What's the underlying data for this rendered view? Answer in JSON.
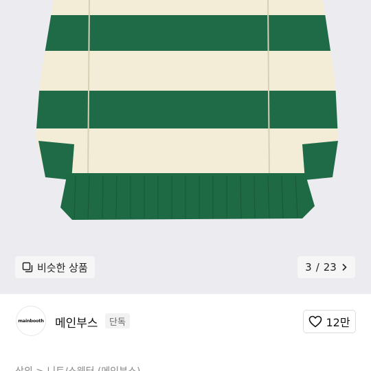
{
  "product_image": {
    "similar_button": {
      "icon": "similar-items-icon",
      "label": "비슷한 상품"
    },
    "counter": {
      "current": "3",
      "separator": "/",
      "total": "23",
      "icon": "chevron-right-icon"
    },
    "colors": {
      "stripe_green": "#1f6b47",
      "stripe_cream": "#f3ecd6",
      "background": "#ececf0"
    }
  },
  "brand": {
    "logo_text": "mainbooth",
    "name": "메인부스",
    "badge": "단독"
  },
  "like": {
    "icon": "heart-icon",
    "count": "12만"
  },
  "breadcrumb": {
    "text": "상의 > 니트/스웨터 (메인부스)"
  }
}
